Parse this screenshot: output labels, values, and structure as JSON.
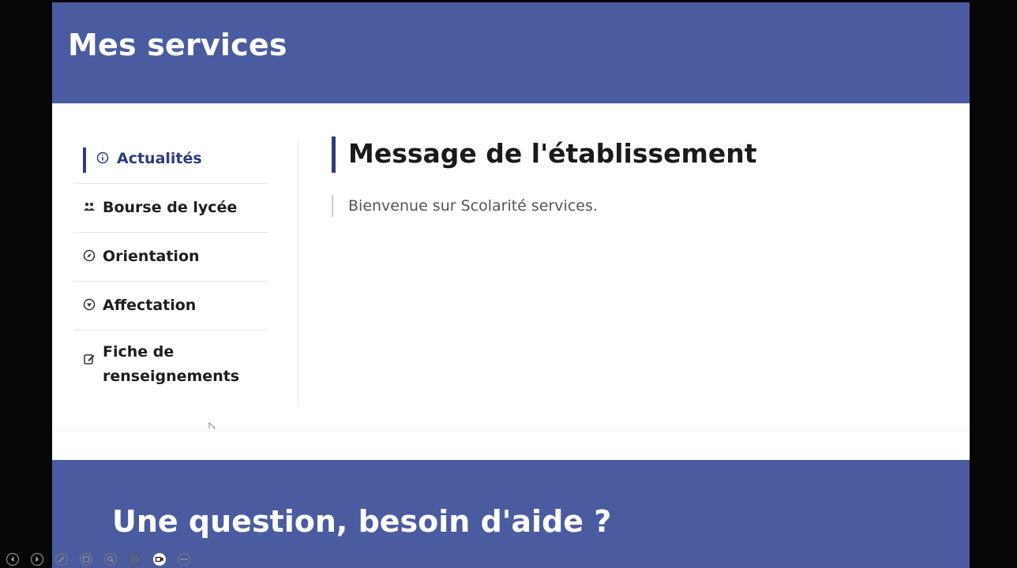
{
  "header": {
    "title": "Mes services"
  },
  "sidebar": {
    "items": [
      {
        "label": "Actualités",
        "icon": "info-icon",
        "active": true
      },
      {
        "label": "Bourse de lycée",
        "icon": "people-icon",
        "active": false
      },
      {
        "label": "Orientation",
        "icon": "compass-icon",
        "active": false
      },
      {
        "label": "Affectation",
        "icon": "location-icon",
        "active": false
      },
      {
        "label": "Fiche de renseignements",
        "icon": "edit-icon",
        "active": false
      }
    ]
  },
  "main": {
    "heading": "Message de l'établissement",
    "message": "Bienvenue sur Scolarité services."
  },
  "footer": {
    "title": "Une question, besoin d'aide ?"
  },
  "toolbar": {
    "buttons": [
      "previous-icon",
      "next-icon",
      "pen-icon",
      "slides-icon",
      "zoom-icon",
      "subtitles-icon",
      "camera-icon",
      "more-icon"
    ]
  },
  "colors": {
    "band": "#4a5c9f",
    "accent": "#2f3b7e"
  }
}
